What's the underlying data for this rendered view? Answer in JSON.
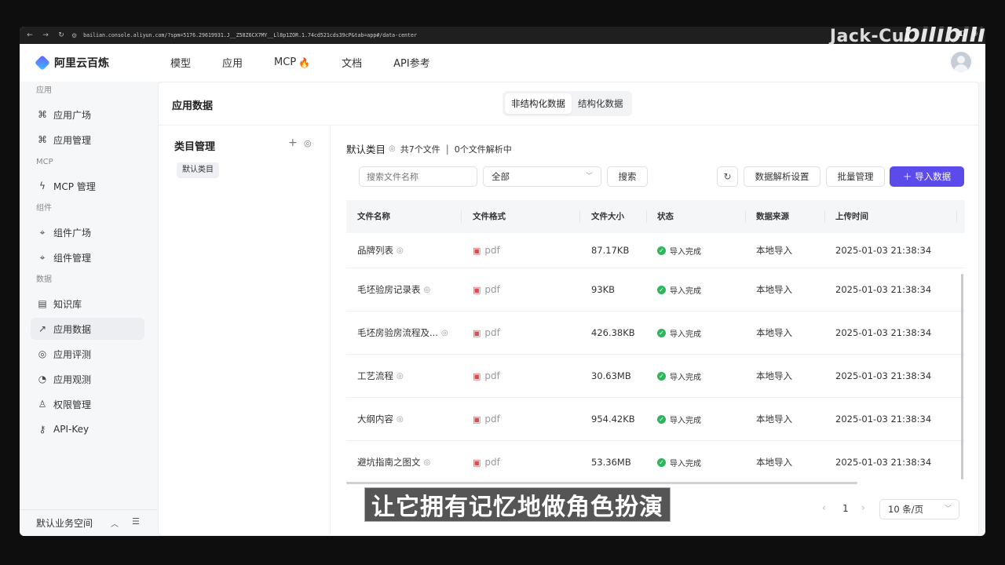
{
  "browser": {
    "url": "bailian.console.aliyun.com/?spm=5176.29619931.J__Z58Z6CX7MY__Ll8p1ZOR.1.74cd521cds39cP&tab=app#/data-center"
  },
  "overlay": {
    "watermark": "Jack-Cui",
    "logo_text": "bilibili",
    "subtitle": "让它拥有记忆地做角色扮演"
  },
  "brand": {
    "name": "阿里云百炼"
  },
  "topnav": [
    "模型",
    "应用",
    "MCP",
    "文档",
    "API参考"
  ],
  "sidebar": {
    "groups": [
      {
        "label": "应用",
        "items": [
          {
            "label": "应用广场",
            "icon": "grid-icon"
          },
          {
            "label": "应用管理",
            "icon": "grid-icon"
          }
        ]
      },
      {
        "label": "MCP",
        "items": [
          {
            "label": "MCP 管理",
            "icon": "mcp-icon"
          }
        ]
      },
      {
        "label": "组件",
        "items": [
          {
            "label": "组件广场",
            "icon": "puzzle-icon"
          },
          {
            "label": "组件管理",
            "icon": "puzzle-icon"
          }
        ]
      },
      {
        "label": "数据",
        "items": [
          {
            "label": "知识库",
            "icon": "book-icon"
          },
          {
            "label": "应用数据",
            "icon": "chart-icon",
            "active": true
          },
          {
            "label": "应用评测",
            "icon": "compass-icon"
          },
          {
            "label": "应用观测",
            "icon": "pie-icon"
          },
          {
            "label": "权限管理",
            "icon": "user-icon"
          },
          {
            "label": "API-Key",
            "icon": "key-icon"
          }
        ]
      }
    ],
    "footer": "默认业务空间"
  },
  "main": {
    "title": "应用数据",
    "segments": [
      "非结构化数据",
      "结构化数据"
    ],
    "category_panel": {
      "title": "类目管理",
      "tag": "默认类目"
    },
    "crumb": {
      "category": "默认类目",
      "file_count": "共7个文件",
      "parsing": "0个文件解析中"
    },
    "toolbar": {
      "search_placeholder": "搜索文件名称",
      "filter_value": "全部",
      "search_btn": "搜索",
      "parse_settings": "数据解析设置",
      "batch": "批量管理",
      "import": "导入数据"
    },
    "table": {
      "headers": [
        "文件名称",
        "文件格式",
        "文件大小",
        "状态",
        "数据来源",
        "上传时间"
      ],
      "rows": [
        {
          "name": "品牌列表",
          "format": "pdf",
          "size": "87.17KB",
          "status": "导入完成",
          "source": "本地导入",
          "time": "2025-01-03 21:38:34"
        },
        {
          "name": "毛坯验房记录表",
          "format": "pdf",
          "size": "93KB",
          "status": "导入完成",
          "source": "本地导入",
          "time": "2025-01-03 21:38:34"
        },
        {
          "name": "毛坯房验房流程及...",
          "format": "pdf",
          "size": "426.38KB",
          "status": "导入完成",
          "source": "本地导入",
          "time": "2025-01-03 21:38:34"
        },
        {
          "name": "工艺流程",
          "format": "pdf",
          "size": "30.63MB",
          "status": "导入完成",
          "source": "本地导入",
          "time": "2025-01-03 21:38:34"
        },
        {
          "name": "大纲内容",
          "format": "pdf",
          "size": "954.42KB",
          "status": "导入完成",
          "source": "本地导入",
          "time": "2025-01-03 21:38:34"
        },
        {
          "name": "避坑指南之图文",
          "format": "pdf",
          "size": "53.36MB",
          "status": "导入完成",
          "source": "本地导入",
          "time": "2025-01-03 21:38:34"
        }
      ]
    },
    "pager": {
      "page": "1",
      "page_size": "10 条/页"
    }
  },
  "colors": {
    "primary": "#5b4bea",
    "success": "#2fb55d",
    "pdf": "#e5484d"
  }
}
